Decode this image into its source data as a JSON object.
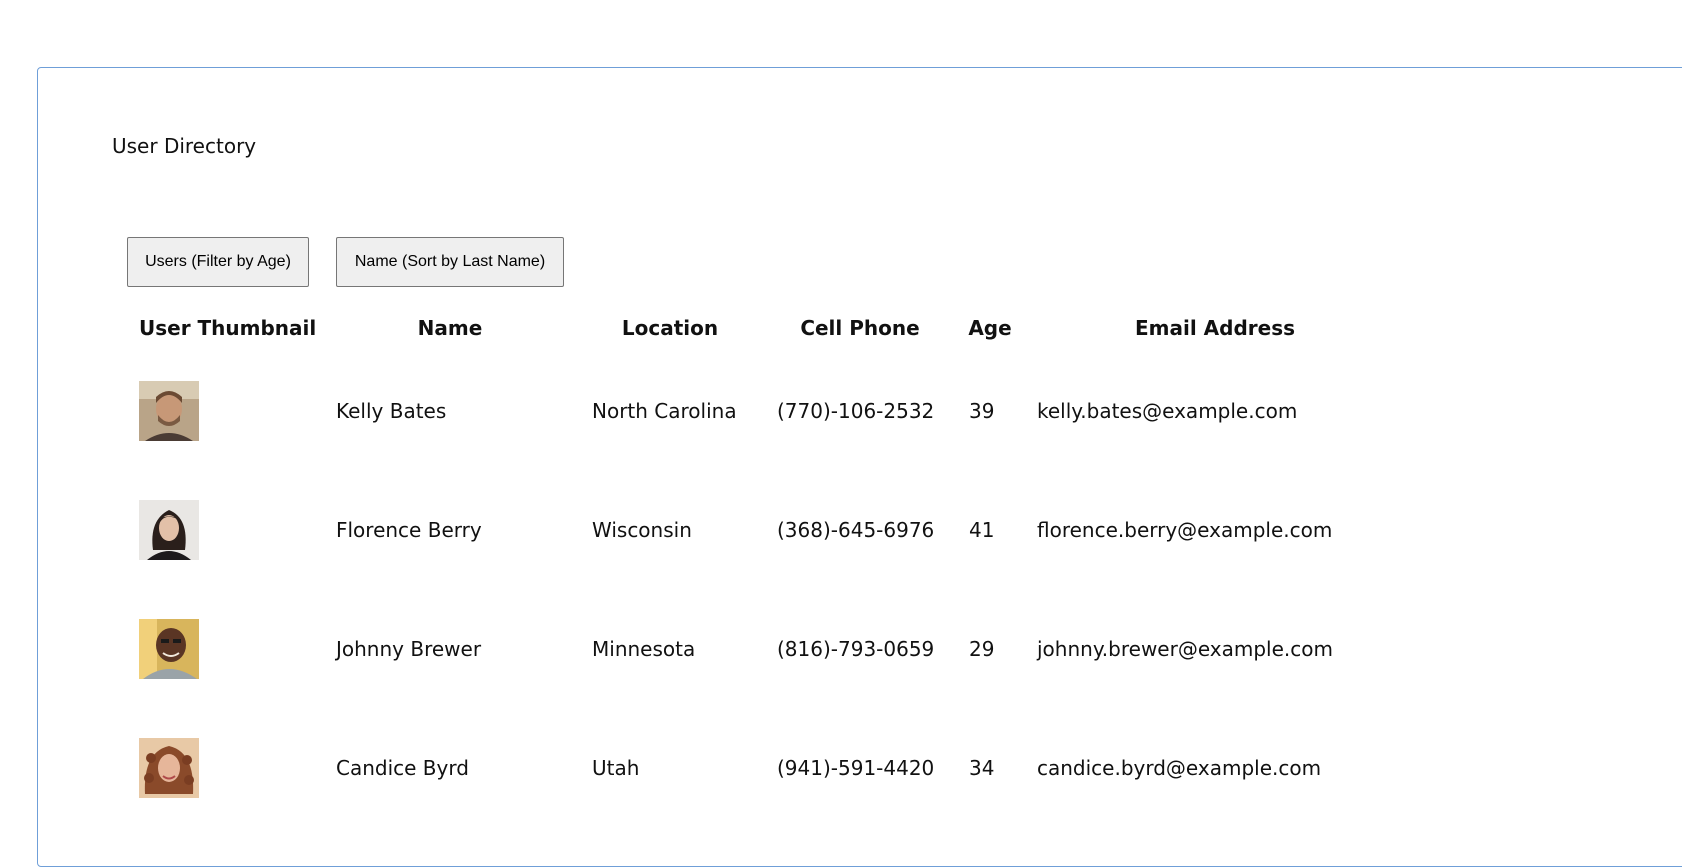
{
  "page": {
    "title": "User Directory"
  },
  "toolbar": {
    "filter_label": "Users (Filter by Age)",
    "sort_label": "Name (Sort by Last Name)"
  },
  "table": {
    "headers": [
      "User Thumbnail",
      "Name",
      "Location",
      "Cell Phone",
      "Age",
      "Email Address"
    ],
    "rows": [
      {
        "name": "Kelly Bates",
        "location": "North Carolina",
        "phone": "(770)-106-2532",
        "age": "39",
        "email": "kelly.bates@example.com"
      },
      {
        "name": "Florence Berry",
        "location": "Wisconsin",
        "phone": "(368)-645-6976",
        "age": "41",
        "email": "florence.berry@example.com"
      },
      {
        "name": "Johnny Brewer",
        "location": "Minnesota",
        "phone": "(816)-793-0659",
        "age": "29",
        "email": "johnny.brewer@example.com"
      },
      {
        "name": "Candice Byrd",
        "location": "Utah",
        "phone": "(941)-591-4420",
        "age": "34",
        "email": "candice.byrd@example.com"
      }
    ]
  },
  "colors": {
    "panel_border": "#6f9fd8",
    "button_bg": "#efefef",
    "button_border": "#767676"
  }
}
